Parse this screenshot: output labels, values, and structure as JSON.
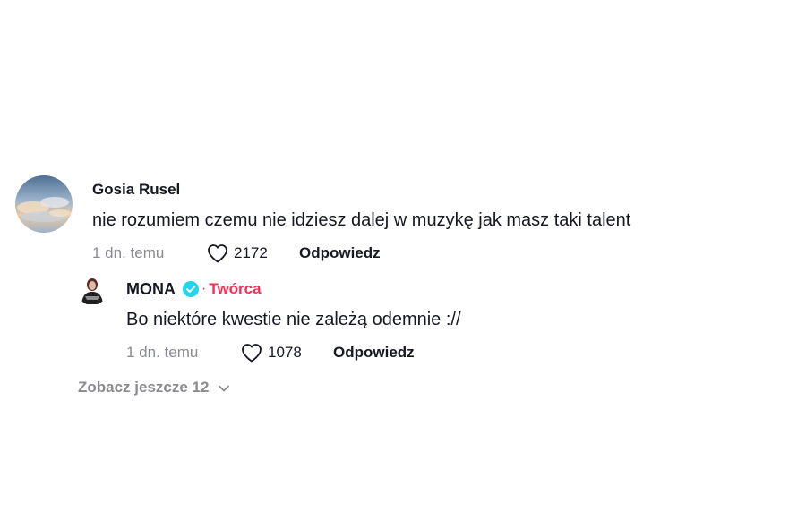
{
  "comment": {
    "username": "Gosia Rusel",
    "text": "nie rozumiem czemu nie idziesz dalej w muzykę jak masz taki talent",
    "time": "1 dn. temu",
    "likes": "2172",
    "reply_label": "Odpowiedz"
  },
  "reply": {
    "username": "MONA",
    "separator": "·",
    "creator_label": "Twórca",
    "text": "Bo niektóre kwestie nie zależą odemnie ://",
    "time": "1 dn. temu",
    "likes": "1078",
    "reply_label": "Odpowiedz"
  },
  "view_more": {
    "label": "Zobacz jeszcze 12"
  },
  "colors": {
    "text": "#161823",
    "secondary": "#8a8b91",
    "creator": "#fe2c55",
    "verified": "#20d5ec"
  },
  "icons": {
    "like": "heart-outline-icon",
    "verified": "verified-badge-icon",
    "expand": "chevron-down-icon"
  }
}
